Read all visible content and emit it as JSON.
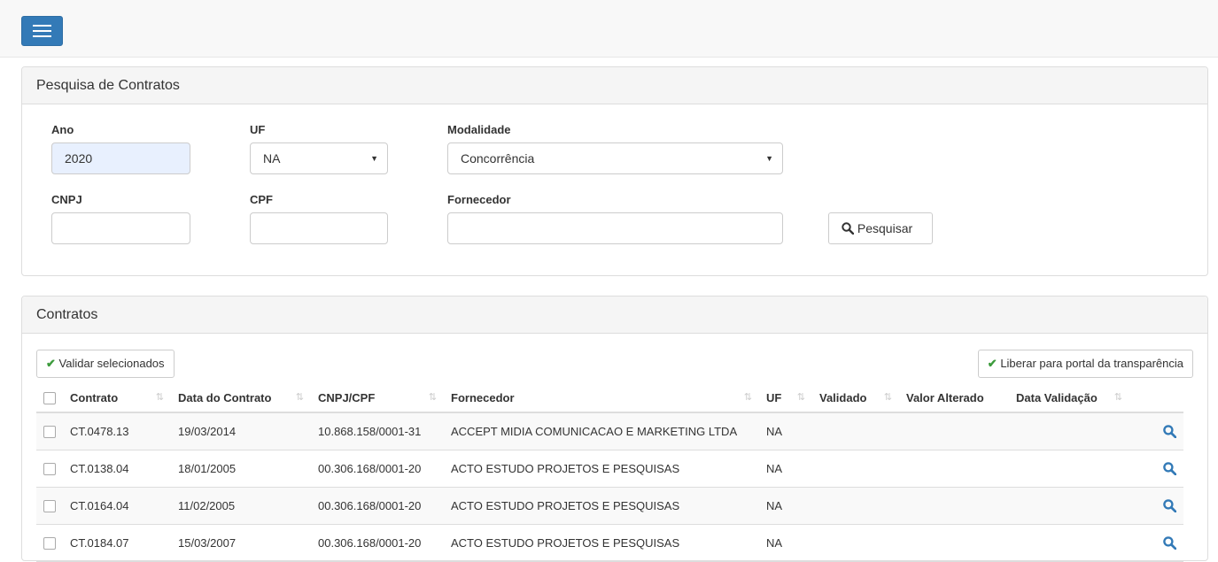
{
  "search_panel": {
    "title": "Pesquisa de Contratos",
    "ano_label": "Ano",
    "ano_value": "2020",
    "uf_label": "UF",
    "uf_value": "NA",
    "modalidade_label": "Modalidade",
    "modalidade_value": "Concorrência",
    "cnpj_label": "CNPJ",
    "cnpj_value": "",
    "cpf_label": "CPF",
    "cpf_value": "",
    "fornecedor_label": "Fornecedor",
    "fornecedor_value": "",
    "search_button": "Pesquisar"
  },
  "contracts_panel": {
    "title": "Contratos",
    "validate_button": "Validar selecionados",
    "release_button": "Liberar para portal da transparência",
    "columns": [
      "Contrato",
      "Data do Contrato",
      "CNPJ/CPF",
      "Fornecedor",
      "UF",
      "Validado",
      "Valor Alterado",
      "Data Validação"
    ],
    "rows": [
      {
        "contrato": "CT.0478.13",
        "data": "19/03/2014",
        "cnpj": "10.868.158/0001-31",
        "fornecedor": "ACCEPT MIDIA COMUNICACAO E MARKETING LTDA",
        "uf": "NA",
        "validado": "",
        "valor_alterado": "",
        "data_validacao": ""
      },
      {
        "contrato": "CT.0138.04",
        "data": "18/01/2005",
        "cnpj": "00.306.168/0001-20",
        "fornecedor": "ACTO ESTUDO PROJETOS E PESQUISAS",
        "uf": "NA",
        "validado": "",
        "valor_alterado": "",
        "data_validacao": ""
      },
      {
        "contrato": "CT.0164.04",
        "data": "11/02/2005",
        "cnpj": "00.306.168/0001-20",
        "fornecedor": "ACTO ESTUDO PROJETOS E PESQUISAS",
        "uf": "NA",
        "validado": "",
        "valor_alterado": "",
        "data_validacao": ""
      },
      {
        "contrato": "CT.0184.07",
        "data": "15/03/2007",
        "cnpj": "00.306.168/0001-20",
        "fornecedor": "ACTO ESTUDO PROJETOS E PESQUISAS",
        "uf": "NA",
        "validado": "",
        "valor_alterado": "",
        "data_validacao": ""
      }
    ]
  },
  "icons": {
    "menu": "hamburger-icon",
    "search": "search-icon",
    "check": "check-icon",
    "sort": "sort-icon",
    "view": "magnifier-icon"
  },
  "colors": {
    "primary": "#337ab7",
    "success_check": "#3c9b3c",
    "autofill": "#e8f0fe"
  }
}
